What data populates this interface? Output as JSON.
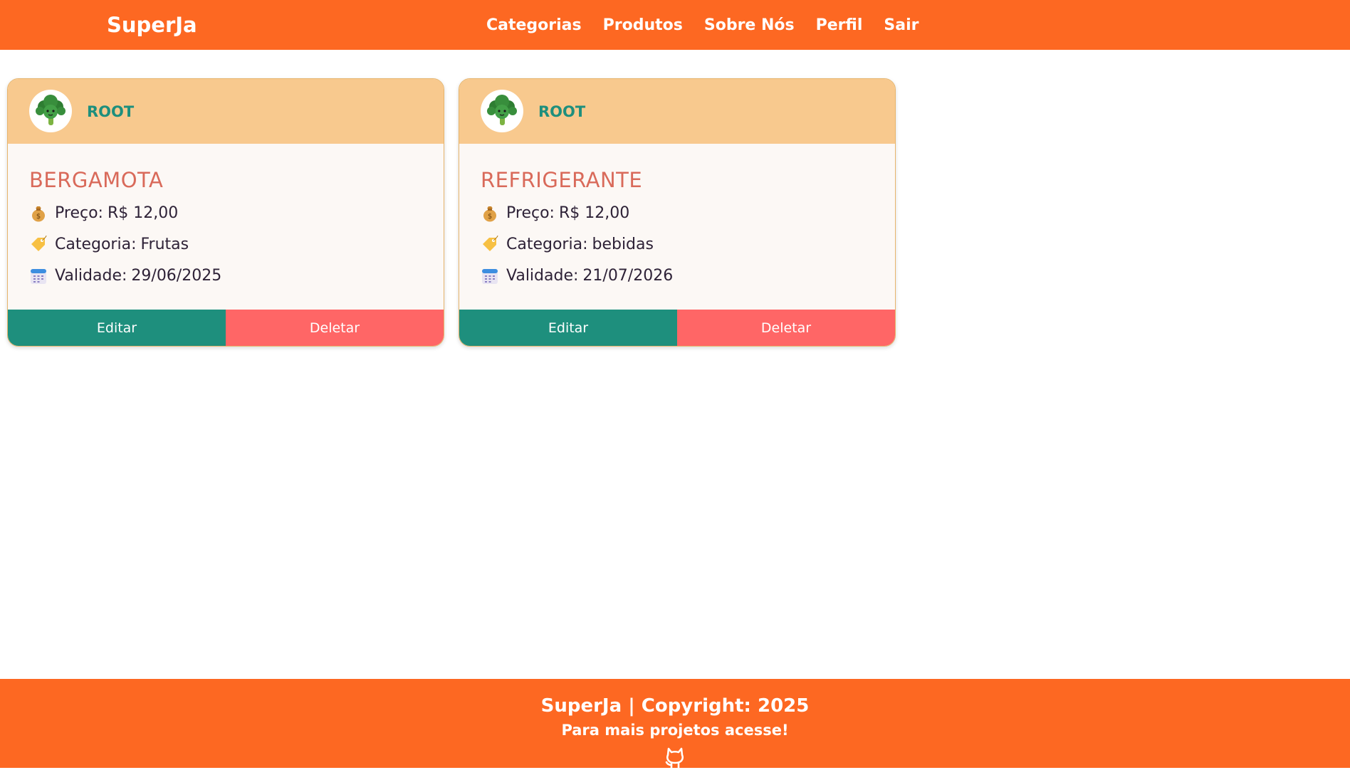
{
  "navbar": {
    "brand": "SuperJa",
    "links": [
      "Categorias",
      "Produtos",
      "Sobre Nós",
      "Perfil",
      "Sair"
    ]
  },
  "products": [
    {
      "owner": "ROOT",
      "name": "BERGAMOTA",
      "price_label": "Preço:",
      "price": "R$ 12,00",
      "category_label": "Categoria:",
      "category": "Frutas",
      "validity_label": "Validade:",
      "validity": "29/06/2025",
      "edit_label": "Editar",
      "delete_label": "Deletar"
    },
    {
      "owner": "ROOT",
      "name": "REFRIGERANTE",
      "price_label": "Preço:",
      "price": "R$ 12,00",
      "category_label": "Categoria:",
      "category": "bebidas",
      "validity_label": "Validade:",
      "validity": "21/07/2026",
      "edit_label": "Editar",
      "delete_label": "Deletar"
    }
  ],
  "footer": {
    "copyright": "SuperJa | Copyright: 2025",
    "subtitle": "Para mais projetos acesse!",
    "icon": "github-icon"
  },
  "icons": {
    "avatar": "broccoli-icon",
    "price": "money-bag-icon",
    "category": "label-tag-icon",
    "validity": "calendar-icon"
  },
  "colors": {
    "brand_orange": "#fd6822",
    "card_header": "#f8c98e",
    "card_body": "#fcf8f5",
    "edit_button": "#1e8f7d",
    "delete_button": "#ff6666",
    "product_name": "#d96a5a",
    "owner_name": "#1e8f7d"
  }
}
